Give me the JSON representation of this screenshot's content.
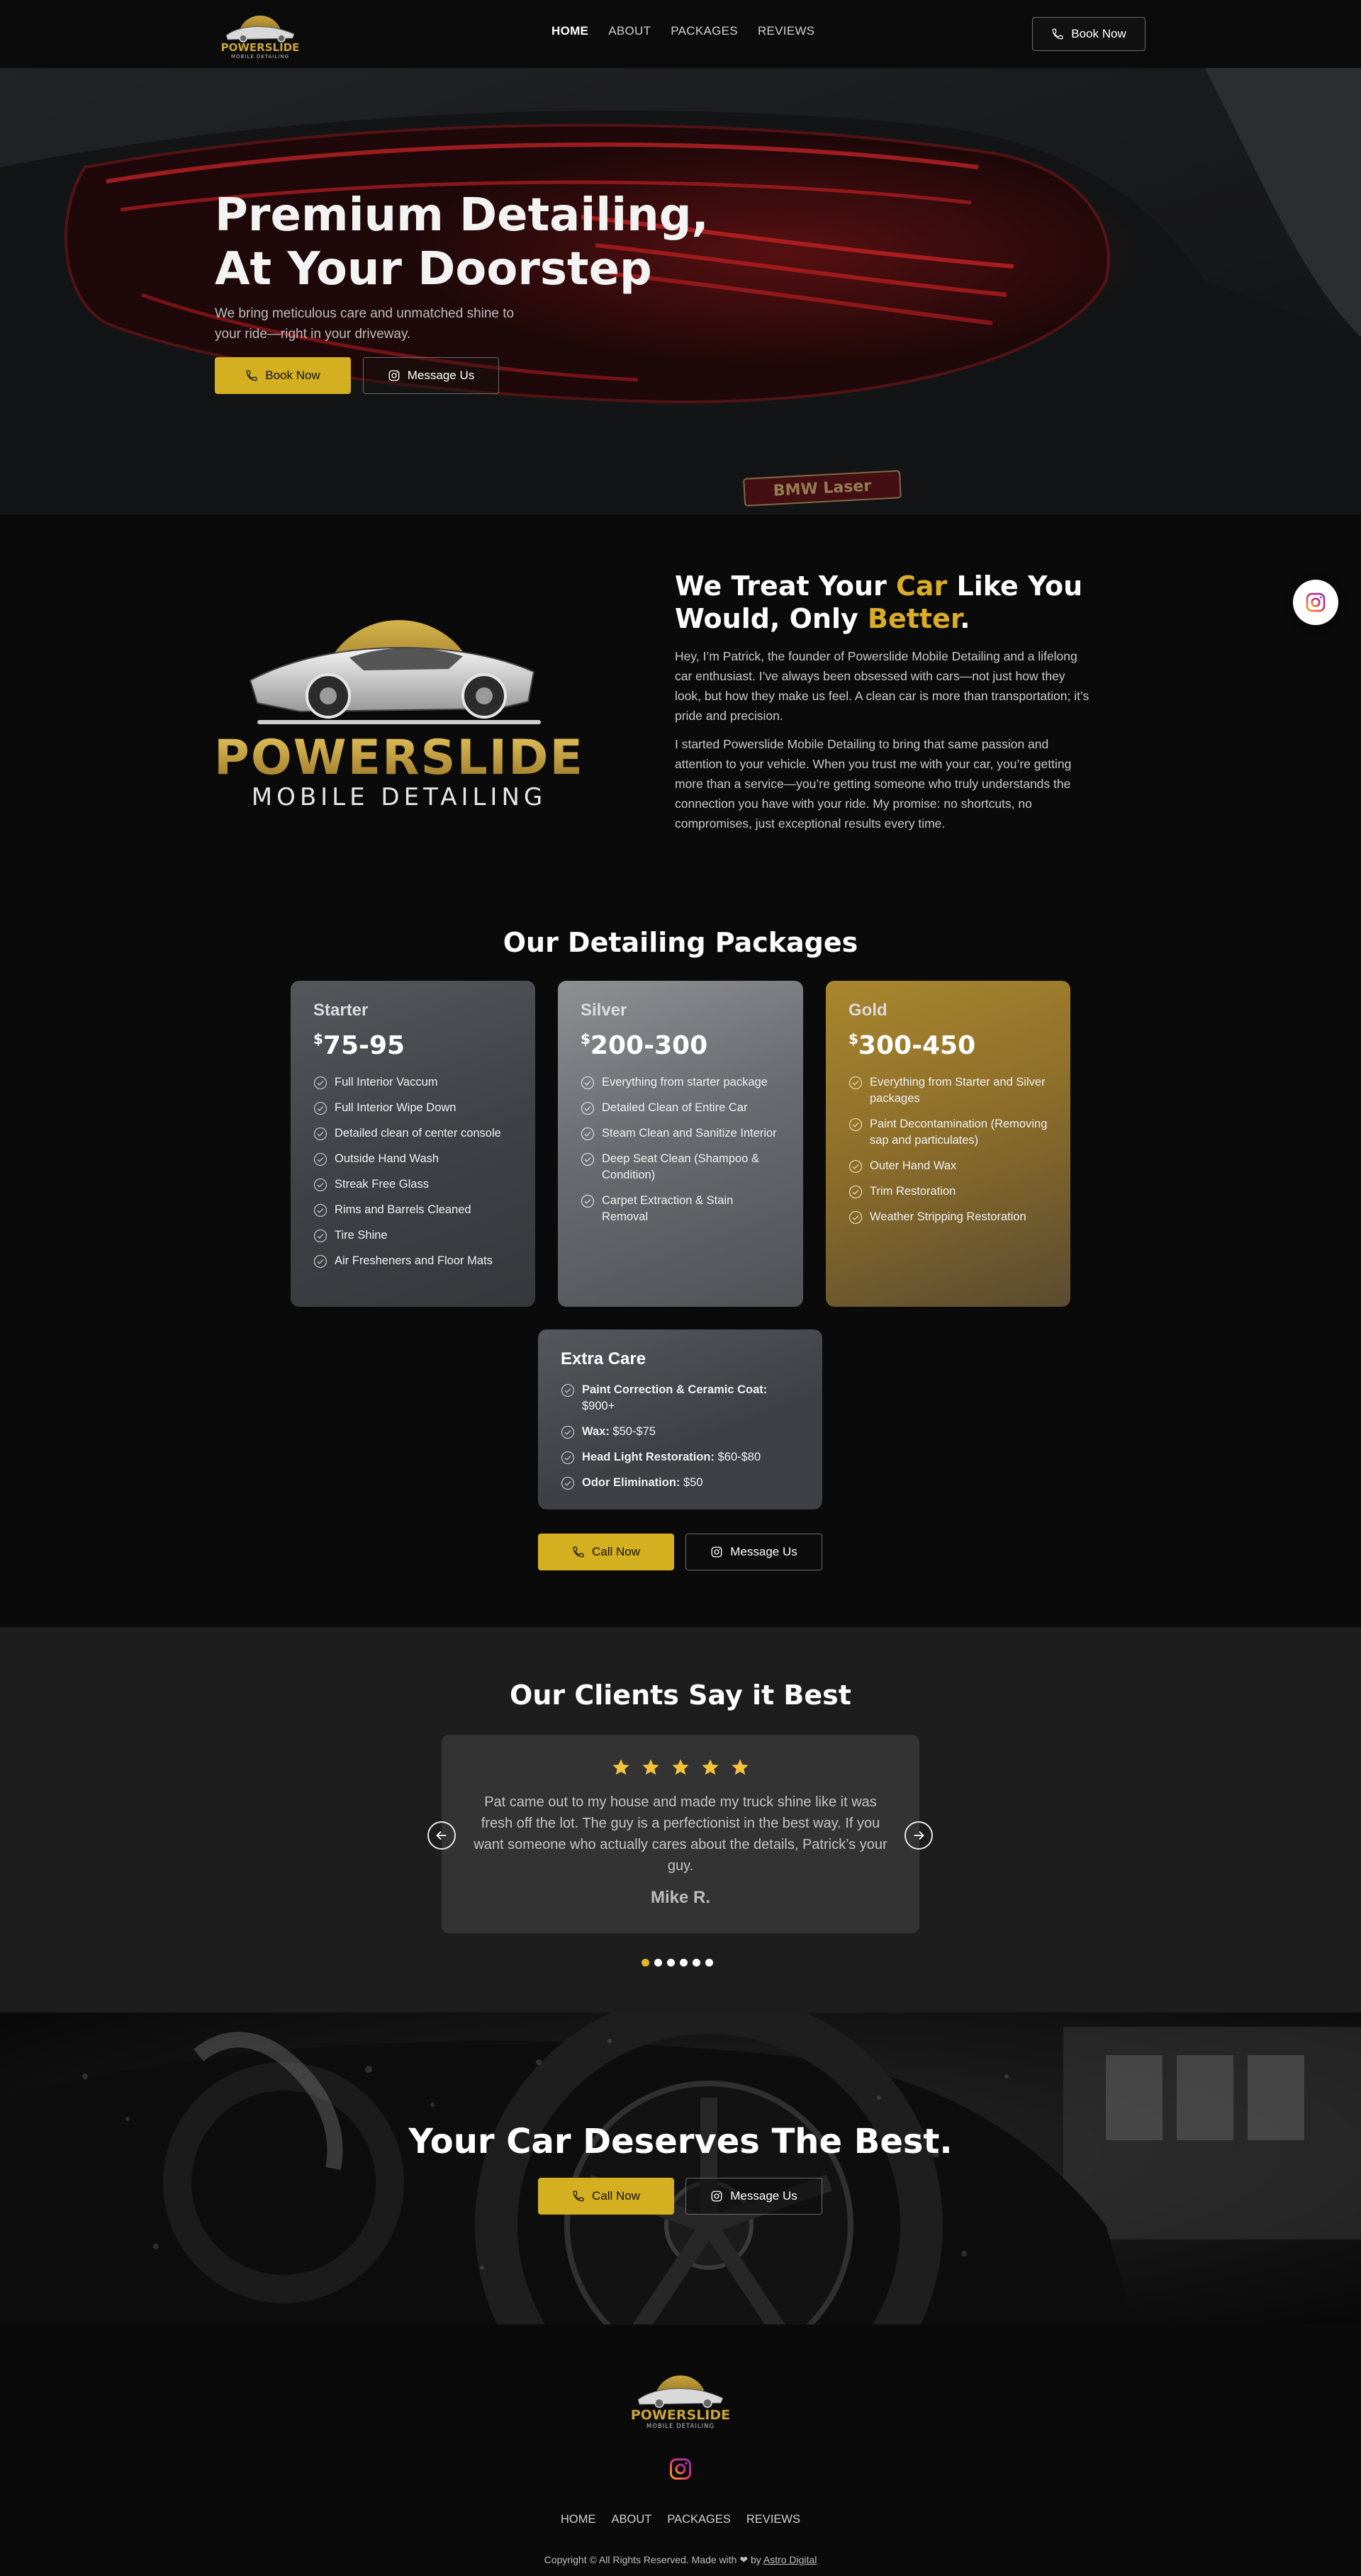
{
  "brand": {
    "name": "POWERSLIDE",
    "tagline": "MOBILE DETAILING"
  },
  "nav": {
    "links": [
      "HOME",
      "ABOUT",
      "PACKAGES",
      "REVIEWS"
    ],
    "book_label": "Book Now"
  },
  "hero": {
    "title_line1": "Premium Detailing,",
    "title_line2": "At Your Doorstep",
    "subtitle": "We bring meticulous care and unmatched shine to your ride—right in your driveway.",
    "book_label": "Book Now",
    "message_label": "Message Us",
    "plate_text": "BMW Laser"
  },
  "about": {
    "title_a": "We Treat Your ",
    "title_b": "Car",
    "title_c": " Like You Would, Only ",
    "title_d": "Better",
    "title_e": ".",
    "p1": "Hey, I’m Patrick, the founder of Powerslide Mobile Detailing and a lifelong car enthusiast. I’ve always been obsessed with cars—not just how they look, but how they make us feel. A clean car is more than transportation; it’s pride and precision.",
    "p2": "I started Powerslide Mobile Detailing to bring that same passion and attention to your vehicle. When you trust me with your car, you’re getting more than a service—you’re getting someone who truly understands the connection you have with your ride. My promise: no shortcuts, no compromises, just exceptional results every time."
  },
  "packages": {
    "title": "Our Detailing Packages",
    "starter": {
      "name": "Starter",
      "currency": "$",
      "price": "75-95",
      "items": [
        "Full Interior Vaccum",
        "Full Interior Wipe Down",
        "Detailed clean of center console",
        "Outside Hand Wash",
        "Streak Free Glass",
        "Rims and Barrels Cleaned",
        "Tire Shine",
        "Air Fresheners and Floor Mats"
      ]
    },
    "silver": {
      "name": "Silver",
      "currency": "$",
      "price": "200-300",
      "items": [
        "Everything from starter package",
        "Detailed Clean of Entire Car",
        "Steam Clean and Sanitize Interior",
        "Deep Seat Clean (Shampoo & Condition)",
        "Carpet Extraction & Stain Removal"
      ]
    },
    "gold": {
      "name": "Gold",
      "currency": "$",
      "price": "300-450",
      "items": [
        "Everything from Starter and Silver packages",
        "Paint Decontamination (Removing sap and particulates)",
        "Outer Hand Wax",
        "Trim Restoration",
        "Weather Stripping Restoration"
      ]
    },
    "extra": {
      "name": "Extra Care",
      "items": [
        {
          "label": "Paint Correction & Ceramic Coat:",
          "price": " $900+"
        },
        {
          "label": "Wax:",
          "price": " $50-$75"
        },
        {
          "label": "Head Light Restoration:",
          "price": " $60-$80"
        },
        {
          "label": "Odor Elimination:",
          "price": " $50"
        }
      ]
    },
    "call_label": "Call Now",
    "message_label": "Message Us"
  },
  "reviews": {
    "title": "Our Clients Say it Best",
    "rating": 5,
    "text": "Pat came out to my house and made my truck shine like it was fresh off the lot. The guy is a perfectionist in the best way. If you want someone who actually cares about the details, Patrick’s your guy.",
    "author": "Mike R.",
    "slides": 6,
    "active_slide": 1
  },
  "cta": {
    "title": "Your Car Deserves The Best.",
    "call_label": "Call Now",
    "message_label": "Message Us"
  },
  "footer": {
    "links": [
      "HOME",
      "ABOUT",
      "PACKAGES",
      "REVIEWS"
    ],
    "copyright": "Copyright © All Rights Reserved. Made with ❤ by ",
    "credit": "Astro Digital"
  },
  "colors": {
    "accent_gold": "#d4af1f",
    "heading_gold": "#d9ac2a",
    "background": "#0a0a0a",
    "reviews_bg": "#1d1d1e"
  },
  "icons": [
    "phone-icon",
    "instagram-icon",
    "check-circle-icon",
    "star-icon",
    "arrow-left-icon",
    "arrow-right-icon"
  ]
}
